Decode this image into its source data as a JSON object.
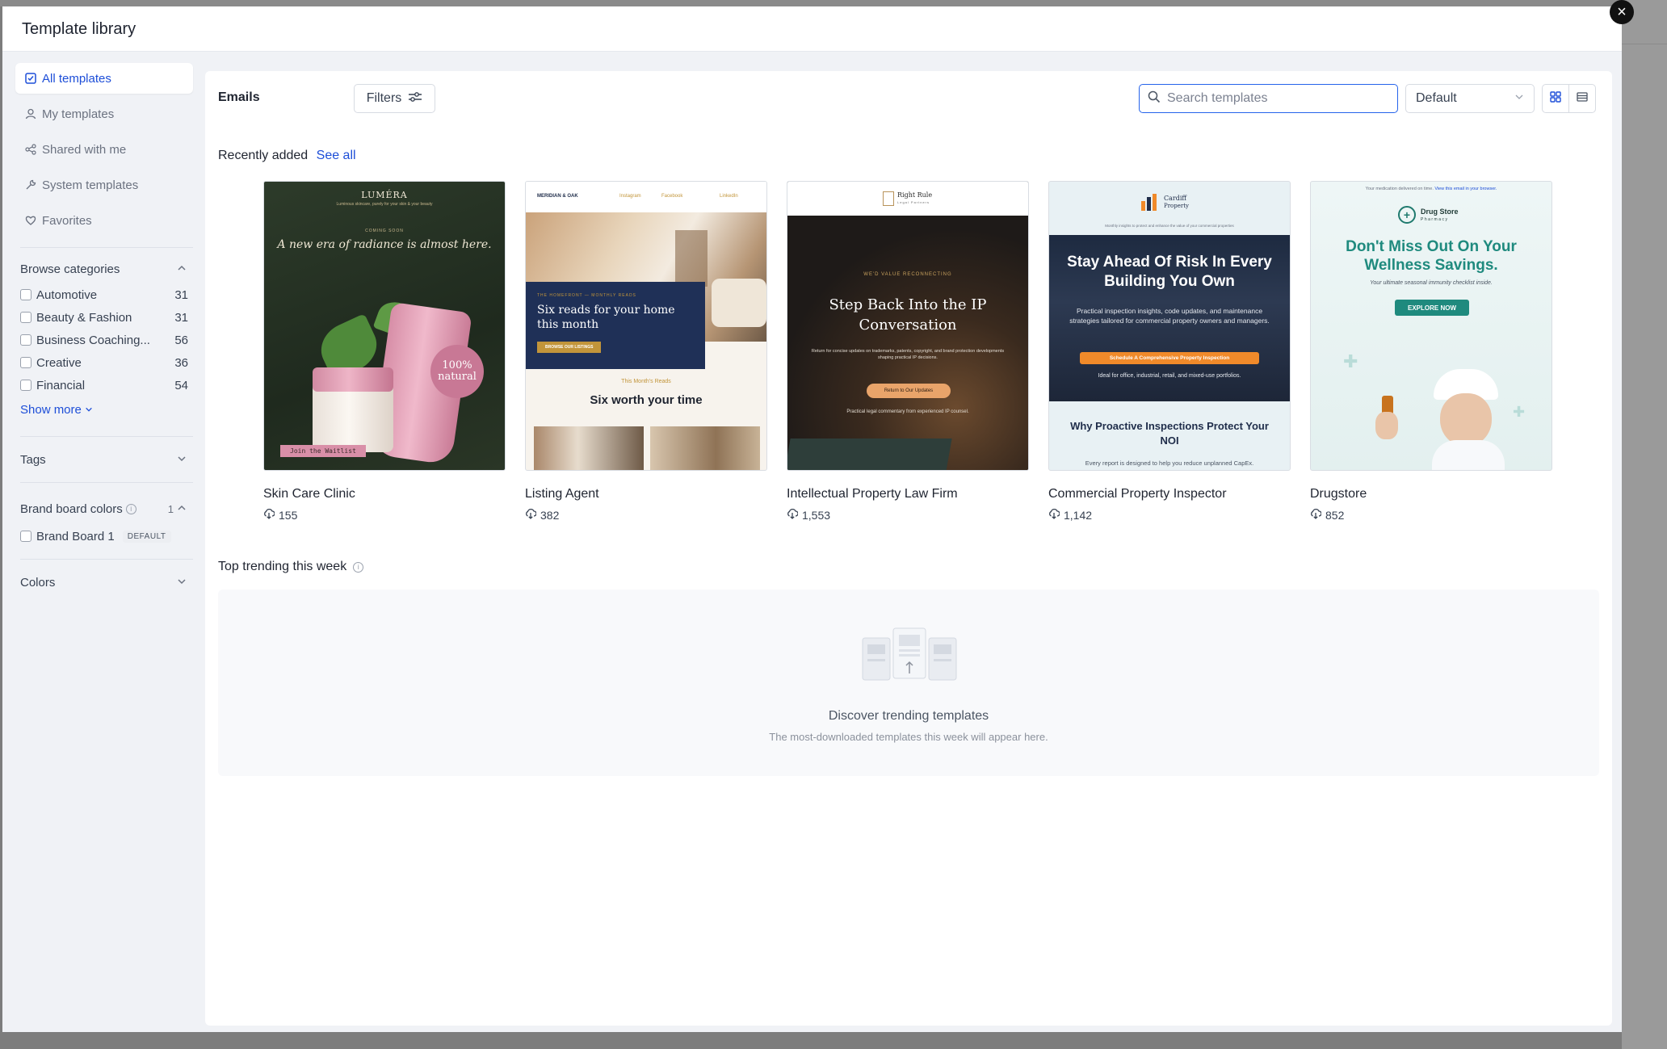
{
  "modal": {
    "title": "Template library",
    "close_icon": "×"
  },
  "sidebar": {
    "nav": [
      {
        "label": "All templates",
        "icon": "checkbox-icon",
        "active": true
      },
      {
        "label": "My templates",
        "icon": "user-icon",
        "active": false
      },
      {
        "label": "Shared with me",
        "icon": "share-icon",
        "active": false
      },
      {
        "label": "System templates",
        "icon": "wrench-icon",
        "active": false
      },
      {
        "label": "Favorites",
        "icon": "heart-icon",
        "active": false
      }
    ],
    "browse": {
      "title": "Browse categories",
      "categories": [
        {
          "name": "Automotive",
          "count": "31"
        },
        {
          "name": "Beauty & Fashion",
          "count": "31"
        },
        {
          "name": "Business Coaching...",
          "count": "56"
        },
        {
          "name": "Creative",
          "count": "36"
        },
        {
          "name": "Financial",
          "count": "54"
        }
      ],
      "show_more": "Show more"
    },
    "tags": {
      "title": "Tags"
    },
    "brand": {
      "title": "Brand board colors",
      "count": "1",
      "board_label": "Brand Board 1",
      "badge": "DEFAULT"
    },
    "colors": {
      "title": "Colors"
    }
  },
  "toolbar": {
    "section_title": "Emails",
    "filters_label": "Filters",
    "search_placeholder": "Search templates",
    "sort_value": "Default"
  },
  "recent": {
    "title": "Recently added",
    "see_all": "See all",
    "cards": [
      {
        "title": "Skin Care Clinic",
        "downloads": "155",
        "thumb": {
          "brand": "LUMÉRA",
          "tagline": "Luminous skincare, purely for your skin & your beauty",
          "kicker": "COMING SOON",
          "headline": "A new era of radiance is almost here.",
          "badge": "100% natural",
          "cta": "Join the Waitlist"
        }
      },
      {
        "title": "Listing Agent",
        "downloads": "382",
        "thumb": {
          "brand": "MERIDIAN & OAK",
          "links": [
            "Instagram",
            "Facebook",
            "LinkedIn"
          ],
          "kicker": "THE HOMEFRONT — MONTHLY READS",
          "headline": "Six reads for your home this month",
          "cta": "BROWSE OUR LISTINGS",
          "sub_kicker": "This Month's Reads",
          "sub_headline": "Six worth your time"
        }
      },
      {
        "title": "Intellectual Property Law Firm",
        "downloads": "1,553",
        "thumb": {
          "brand": "Right Rule",
          "brand_sub": "Legal Partners",
          "kicker": "WE'D VALUE RECONNECTING",
          "headline": "Step Back Into the IP Conversation",
          "body": "Return for concise updates on trademarks, patents, copyright, and brand protection developments shaping practical IP decisions.",
          "cta": "Return to Our Updates",
          "foot": "Practical legal commentary from experienced IP counsel."
        }
      },
      {
        "title": "Commercial Property Inspector",
        "downloads": "1,142",
        "thumb": {
          "brand": "Cardiff",
          "brand_sub": "Property",
          "top": "Monthly insights to protect and enhance the value of your commercial properties",
          "headline": "Stay Ahead Of Risk In Every Building You Own",
          "body": "Practical inspection insights, code updates, and maintenance strategies tailored for commercial property owners and managers.",
          "cta": "Schedule A Comprehensive Property Inspection",
          "note": "Ideal for office, industrial, retail, and mixed-use portfolios.",
          "sub_headline": "Why Proactive Inspections Protect Your NOI",
          "foot": "Every report is designed to help you reduce unplanned CapEx."
        }
      },
      {
        "title": "Drugstore",
        "downloads": "852",
        "thumb": {
          "top": "Your medication delivered on time.",
          "top_link": "View this email in your browser.",
          "brand": "Drug Store",
          "brand_sub": "Pharmacy",
          "headline": "Don't Miss Out On Your Wellness Savings.",
          "sub": "Your ultimate seasonal immunity checklist inside.",
          "cta": "EXPLORE NOW"
        }
      }
    ]
  },
  "trending": {
    "title": "Top trending this week",
    "empty_title": "Discover trending templates",
    "empty_sub": "The most-downloaded templates this week will appear here."
  },
  "colors": {
    "accent": "#1d4ed8",
    "search_border": "#2563eb",
    "backdrop": "#7d7d7d"
  }
}
